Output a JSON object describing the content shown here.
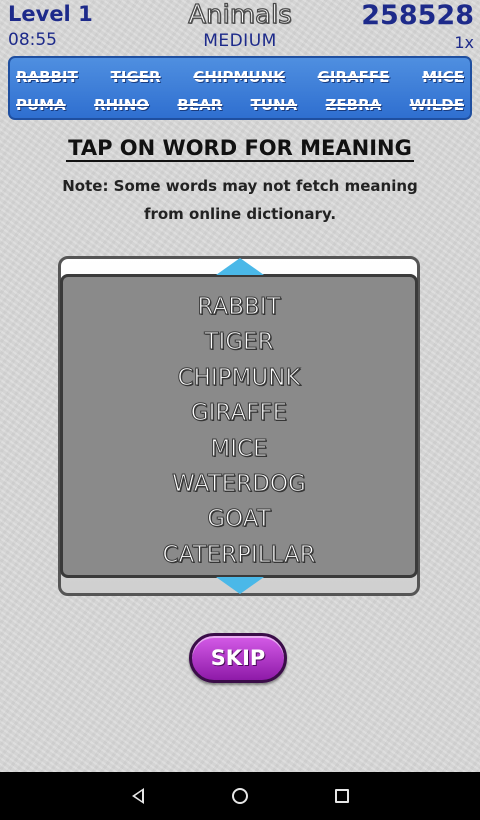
{
  "header": {
    "level": "Level 1",
    "timer": "08:55",
    "category": "Animals",
    "difficulty": "MEDIUM",
    "score": "258528",
    "multiplier": "1x"
  },
  "word_bank": {
    "row1": [
      "RABBIT",
      "TIGER",
      "CHIPMUNK",
      "GIRAFFE",
      "MICE"
    ],
    "row2": [
      "PUMA",
      "RHINO",
      "BEAR",
      "TUNA",
      "ZEBRA",
      "WILDE"
    ]
  },
  "instruction": "TAP ON WORD FOR MEANING",
  "note": "Note: Some words may not fetch meaning from online dictionary.",
  "found_words": [
    "RABBIT",
    "TIGER",
    "CHIPMUNK",
    "GIRAFFE",
    "MICE",
    "WATERDOG",
    "GOAT",
    "CATERPILLAR"
  ],
  "skip_label": "SKIP",
  "colors": {
    "header_text": "#1d2a8a",
    "word_bank_bg": "#2f6fd0",
    "panel_bg": "#8a8a8a",
    "arrow": "#4ab8e8",
    "skip_button": "#b03ccc"
  },
  "icons": [
    "up-arrow-icon",
    "down-arrow-icon",
    "back-icon",
    "home-icon",
    "recents-icon"
  ]
}
